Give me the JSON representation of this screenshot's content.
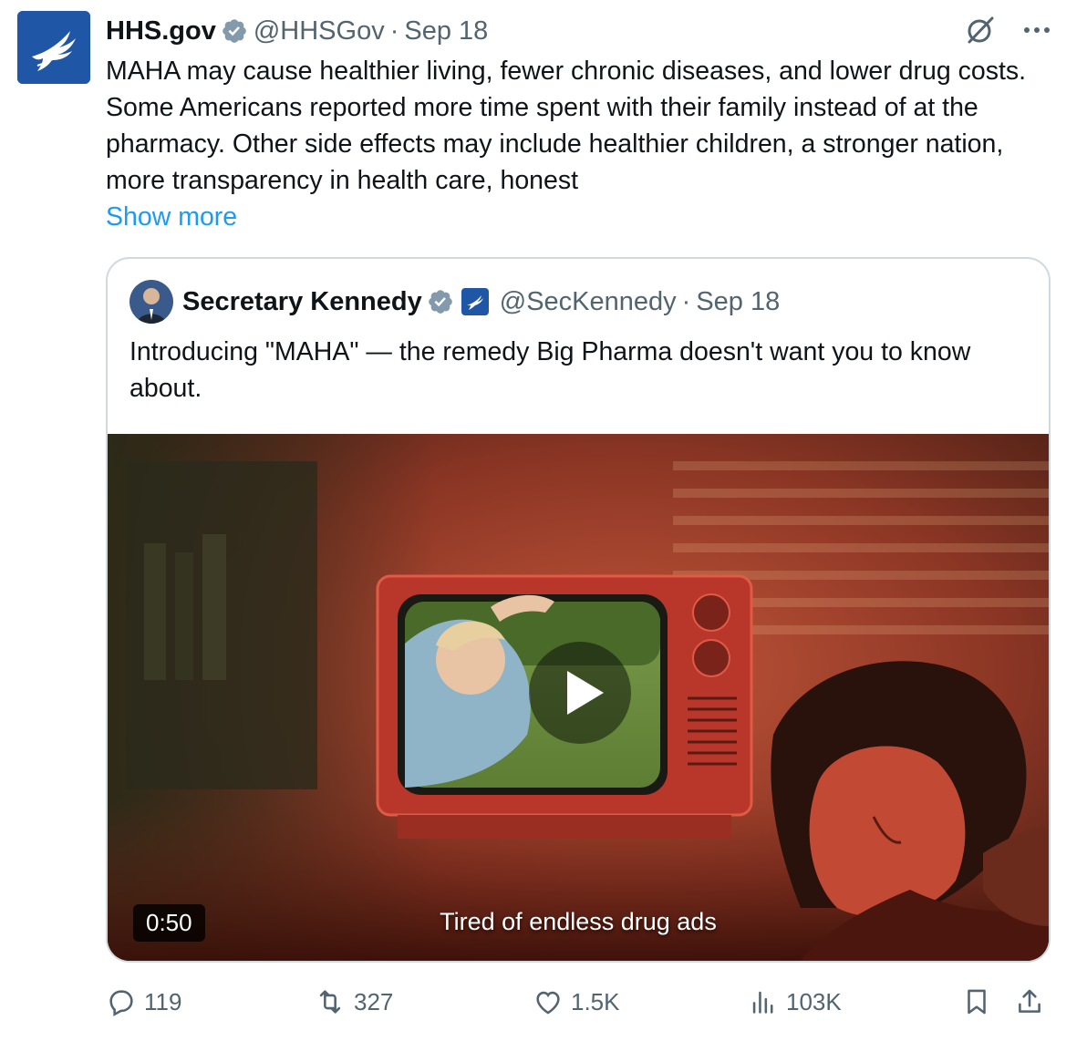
{
  "tweet": {
    "author_name": "HHS.gov",
    "handle": "@HHSGov",
    "separator": "·",
    "date": "Sep 18",
    "text": "MAHA may cause healthier living, fewer chronic diseases, and lower drug costs. Some Americans reported more time spent with their family instead of at the pharmacy. Other side effects may include healthier children, a stronger nation, more transparency in health care, honest",
    "show_more": "Show more"
  },
  "quote": {
    "author_name": "Secretary Kennedy",
    "handle": "@SecKennedy",
    "separator": "·",
    "date": "Sep 18",
    "text": "Introducing \"MAHA\" — the remedy Big Pharma doesn't want you to know about.",
    "video": {
      "duration": "0:50",
      "caption": "Tired of endless drug ads"
    }
  },
  "actions": {
    "replies": "119",
    "reposts": "327",
    "likes": "1.5K",
    "views": "103K"
  },
  "icons": [
    "verified-badge-icon",
    "grok-icon",
    "more-icon",
    "reply-icon",
    "repost-icon",
    "like-icon",
    "views-icon",
    "bookmark-icon",
    "share-icon",
    "play-icon"
  ],
  "colors": {
    "link": "#1d9bf0",
    "muted": "#536471",
    "verified": "#829aab",
    "hhs_blue": "#1f56a6"
  }
}
